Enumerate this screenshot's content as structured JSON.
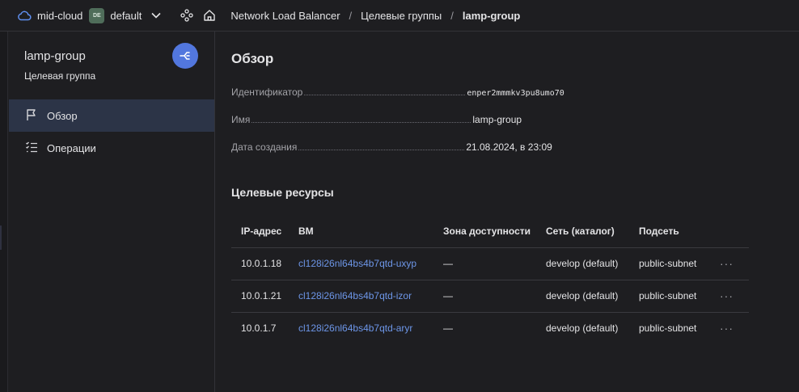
{
  "topbar": {
    "cloud_name": "mid-cloud",
    "folder_badge": "DE",
    "folder_name": "default",
    "breadcrumbs": [
      "Network Load Balancer",
      "Целевые группы",
      "lamp-group"
    ],
    "separator": "/"
  },
  "sidebar": {
    "title": "lamp-group",
    "subtitle": "Целевая группа",
    "items": [
      {
        "label": "Обзор",
        "icon": "flag-icon",
        "active": true
      },
      {
        "label": "Операции",
        "icon": "list-icon",
        "active": false
      }
    ]
  },
  "overview": {
    "heading": "Обзор",
    "fields": [
      {
        "key": "Идентификатор",
        "value": "enper2mmmkv3pu8umo70"
      },
      {
        "key": "Имя",
        "value": "lamp-group"
      },
      {
        "key": "Дата создания",
        "value": "21.08.2024, в 23:09"
      }
    ]
  },
  "targets": {
    "heading": "Целевые ресурсы",
    "columns": [
      "IP-адрес",
      "ВМ",
      "Зона доступности",
      "Сеть (каталог)",
      "Подсеть"
    ],
    "rows": [
      {
        "ip": "10.0.1.18",
        "vm": "cl128i26nl64bs4b7qtd-uxyp",
        "zone": "—",
        "network": "develop (default)",
        "subnet": "public-subnet",
        "actions": "···"
      },
      {
        "ip": "10.0.1.21",
        "vm": "cl128i26nl64bs4b7qtd-izor",
        "zone": "—",
        "network": "develop (default)",
        "subnet": "public-subnet",
        "actions": "···"
      },
      {
        "ip": "10.0.1.7",
        "vm": "cl128i26nl64bs4b7qtd-aryr",
        "zone": "—",
        "network": "develop (default)",
        "subnet": "public-subnet",
        "actions": "···"
      }
    ]
  },
  "colors": {
    "accent": "#5277de",
    "link": "#6d96e8",
    "active_nav": "#2c3447",
    "background": "#1e1e21"
  }
}
